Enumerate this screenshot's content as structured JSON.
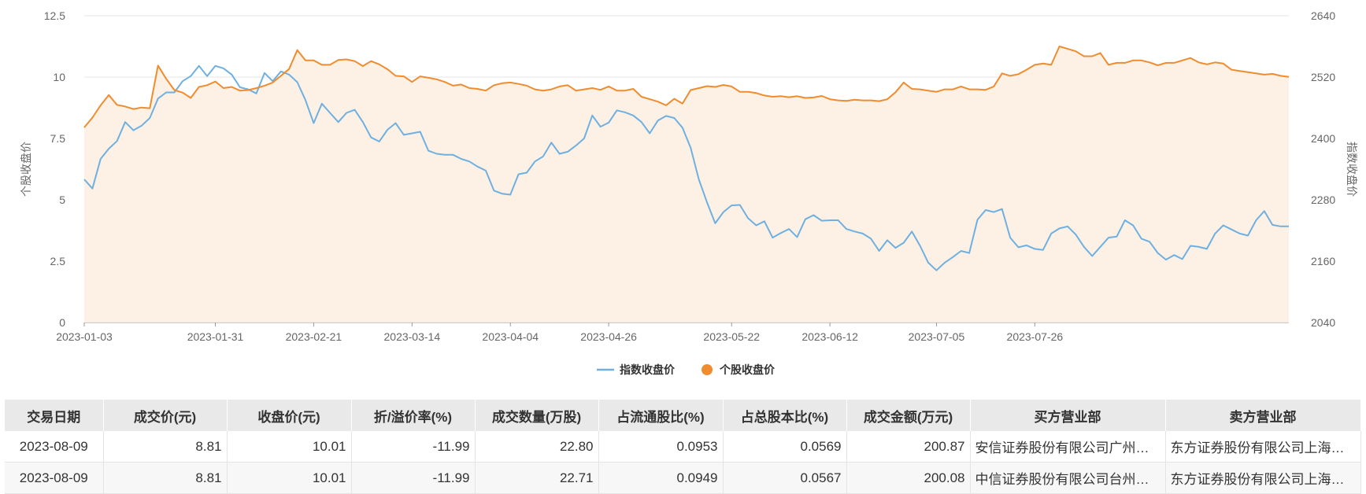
{
  "chart_data": {
    "type": "line",
    "legend_position": "bottom-center",
    "y_left": {
      "label": "个股收盘价",
      "ticks": [
        "0",
        "2.5",
        "5",
        "7.5",
        "10",
        "12.5"
      ],
      "range": [
        0,
        12.5
      ]
    },
    "y_right": {
      "label": "指数收盘价",
      "ticks": [
        "2040",
        "2160",
        "2280",
        "2400",
        "2520",
        "2640"
      ],
      "range": [
        2040,
        2640
      ]
    },
    "x_ticks": [
      "2023-01-03",
      "2023-01-31",
      "2023-02-21",
      "2023-03-14",
      "2023-04-04",
      "2023-04-26",
      "2023-05-22",
      "2023-06-12",
      "2023-07-05",
      "2023-07-26"
    ],
    "series": [
      {
        "name": "指数收盘价",
        "axis": "right",
        "color": "#6fb0e0",
        "values": [
          2320,
          2302,
          2360,
          2380,
          2395,
          2432,
          2416,
          2425,
          2440,
          2478,
          2490,
          2490,
          2512,
          2522,
          2542,
          2522,
          2542,
          2537,
          2525,
          2500,
          2496,
          2488,
          2528,
          2512,
          2531,
          2525,
          2510,
          2475,
          2430,
          2468,
          2450,
          2432,
          2450,
          2456,
          2432,
          2402,
          2394,
          2417,
          2430,
          2407,
          2410,
          2413,
          2376,
          2370,
          2368,
          2368,
          2360,
          2355,
          2345,
          2337,
          2298,
          2292,
          2290,
          2330,
          2333,
          2355,
          2365,
          2392,
          2370,
          2374,
          2386,
          2400,
          2445,
          2423,
          2431,
          2455,
          2451,
          2445,
          2432,
          2410,
          2435,
          2444,
          2440,
          2421,
          2382,
          2320,
          2275,
          2234,
          2256,
          2269,
          2270,
          2244,
          2230,
          2238,
          2206,
          2215,
          2223,
          2207,
          2242,
          2250,
          2239,
          2240,
          2240,
          2223,
          2218,
          2214,
          2204,
          2180,
          2201,
          2186,
          2196,
          2218,
          2190,
          2157,
          2142,
          2157,
          2168,
          2180,
          2176,
          2241,
          2260,
          2256,
          2262,
          2206,
          2187,
          2191,
          2184,
          2182,
          2214,
          2224,
          2228,
          2212,
          2188,
          2170,
          2188,
          2206,
          2208,
          2240,
          2230,
          2204,
          2198,
          2176,
          2163,
          2172,
          2164,
          2190,
          2188,
          2184,
          2214,
          2230,
          2222,
          2214,
          2210,
          2240,
          2258,
          2231,
          2228,
          2228
        ]
      },
      {
        "name": "个股收盘价",
        "axis": "left",
        "color": "#f08c2e",
        "values": [
          7.95,
          8.35,
          8.85,
          9.27,
          8.87,
          8.8,
          8.7,
          8.76,
          8.73,
          10.47,
          9.93,
          9.47,
          9.37,
          9.15,
          9.6,
          9.67,
          9.82,
          9.55,
          9.6,
          9.45,
          9.47,
          9.55,
          9.65,
          9.78,
          10.05,
          10.33,
          11.1,
          10.68,
          10.68,
          10.5,
          10.5,
          10.7,
          10.72,
          10.65,
          10.45,
          10.65,
          10.52,
          10.32,
          10.05,
          10.03,
          9.8,
          10.03,
          9.97,
          9.91,
          9.8,
          9.65,
          9.7,
          9.55,
          9.52,
          9.45,
          9.67,
          9.75,
          9.78,
          9.72,
          9.65,
          9.5,
          9.45,
          9.5,
          9.62,
          9.67,
          9.45,
          9.5,
          9.55,
          9.48,
          9.62,
          9.45,
          9.45,
          9.52,
          9.2,
          9.1,
          9.0,
          8.85,
          9.12,
          8.92,
          9.47,
          9.55,
          9.63,
          9.6,
          9.68,
          9.62,
          9.4,
          9.4,
          9.35,
          9.25,
          9.2,
          9.22,
          9.18,
          9.22,
          9.15,
          9.17,
          9.23,
          9.1,
          9.05,
          9.03,
          9.08,
          9.05,
          9.05,
          9.02,
          9.1,
          9.38,
          9.78,
          9.52,
          9.5,
          9.45,
          9.4,
          9.5,
          9.5,
          9.62,
          9.5,
          9.5,
          9.48,
          9.62,
          10.15,
          10.05,
          10.12,
          10.3,
          10.5,
          10.55,
          10.5,
          11.25,
          11.15,
          11.05,
          10.85,
          10.85,
          10.98,
          10.5,
          10.58,
          10.58,
          10.68,
          10.68,
          10.6,
          10.48,
          10.58,
          10.58,
          10.68,
          10.78,
          10.6,
          10.52,
          10.6,
          10.55,
          10.3,
          10.25,
          10.2,
          10.15,
          10.1,
          10.13,
          10.05,
          10.01
        ]
      }
    ]
  },
  "table": {
    "headers": [
      "交易日期",
      "成交价(元)",
      "收盘价(元)",
      "折/溢价率(%)",
      "成交数量(万股)",
      "占流通股比(%)",
      "占总股本比(%)",
      "成交金额(万元)",
      "买方营业部",
      "卖方营业部"
    ],
    "rows": [
      [
        "2023-08-09",
        "8.81",
        "10.01",
        "-11.99",
        "22.80",
        "0.0953",
        "0.0569",
        "200.87",
        "安信证券股份有限公司广州分…",
        "东方证券股份有限公司上海…"
      ],
      [
        "2023-08-09",
        "8.81",
        "10.01",
        "-11.99",
        "22.71",
        "0.0949",
        "0.0567",
        "200.08",
        "中信证券股份有限公司台州分…",
        "东方证券股份有限公司上海…"
      ]
    ]
  }
}
